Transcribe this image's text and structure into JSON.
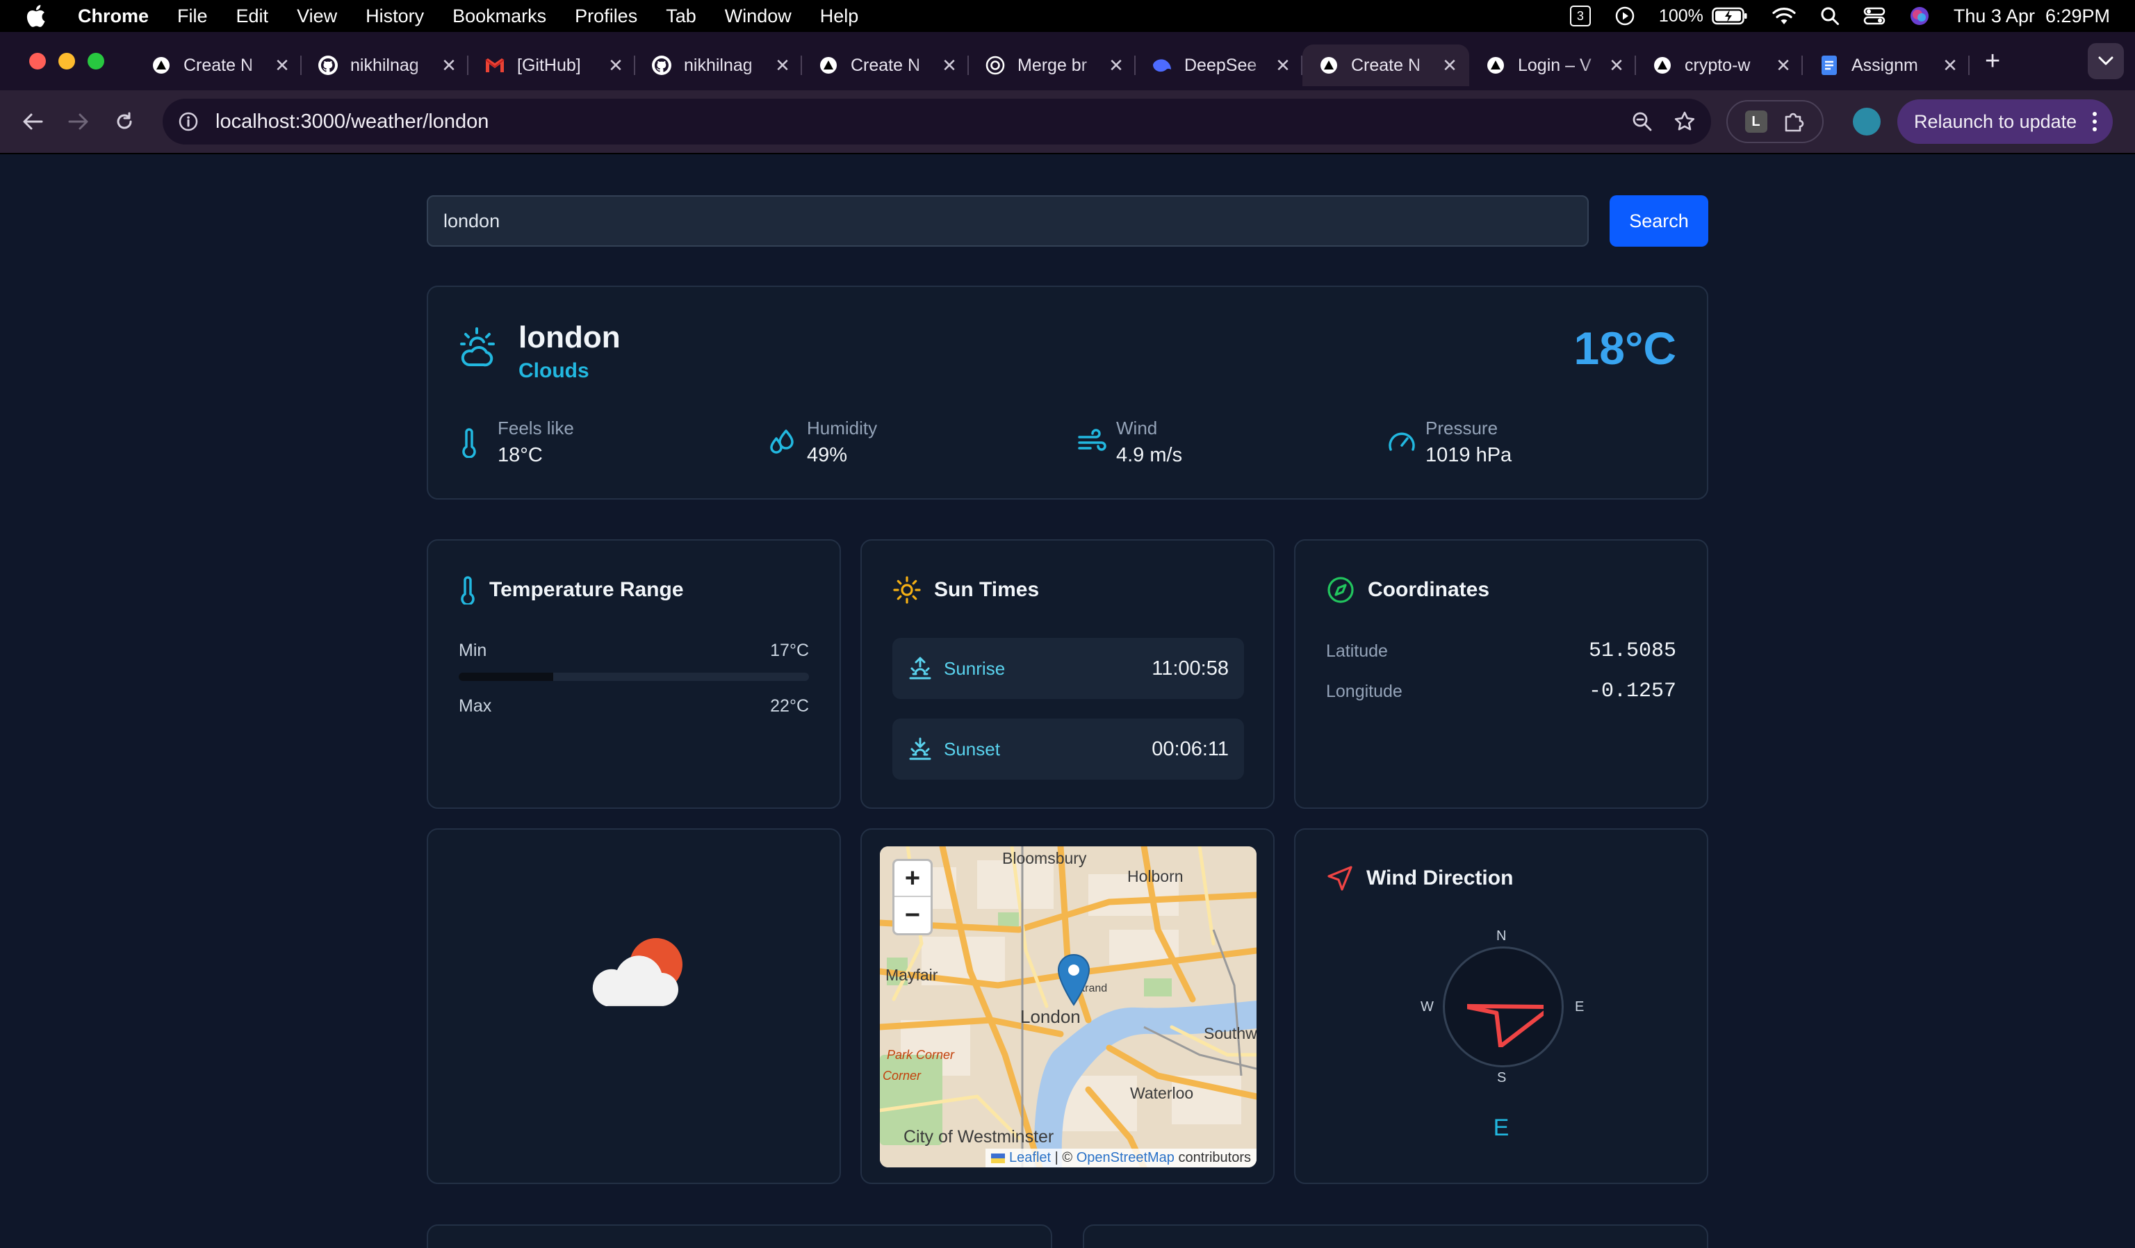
{
  "menubar": {
    "app": "Chrome",
    "items": [
      "File",
      "Edit",
      "View",
      "History",
      "Bookmarks",
      "Profiles",
      "Tab",
      "Window",
      "Help"
    ],
    "battery": "100%",
    "datetime": "Thu 3 Apr  6:29PM",
    "calendar_day": "3"
  },
  "tabs": [
    {
      "label": "Create N",
      "icon": "triangle-icon"
    },
    {
      "label": "nikhilnag",
      "icon": "github-icon"
    },
    {
      "label": "[GitHub]",
      "icon": "gmail-icon"
    },
    {
      "label": "nikhilnag",
      "icon": "github-icon"
    },
    {
      "label": "Create N",
      "icon": "triangle-icon"
    },
    {
      "label": "Merge br",
      "icon": "openai-icon"
    },
    {
      "label": "DeepSee",
      "icon": "deepseek-icon"
    },
    {
      "label": "Create N",
      "icon": "triangle-icon",
      "active": true
    },
    {
      "label": "Login – V",
      "icon": "triangle-icon"
    },
    {
      "label": "crypto-w",
      "icon": "triangle-icon"
    },
    {
      "label": "Assignm",
      "icon": "docs-icon"
    }
  ],
  "toolbar": {
    "url": "localhost:3000/weather/london",
    "ext_letter": "L",
    "relaunch": "Relaunch to update"
  },
  "search": {
    "value": "london",
    "button": "Search"
  },
  "weather": {
    "city": "london",
    "condition": "Clouds",
    "temperature": "18°C",
    "stats": [
      {
        "label": "Feels like",
        "value": "18°C",
        "icon": "thermometer-icon"
      },
      {
        "label": "Humidity",
        "value": "49%",
        "icon": "droplets-icon"
      },
      {
        "label": "Wind",
        "value": "4.9 m/s",
        "icon": "wind-icon"
      },
      {
        "label": "Pressure",
        "value": "1019 hPa",
        "icon": "gauge-icon"
      }
    ]
  },
  "temp_range": {
    "title": "Temperature Range",
    "min_label": "Min",
    "min": "17°C",
    "max_label": "Max",
    "max": "22°C",
    "fill_fraction": 0.27
  },
  "sun_times": {
    "title": "Sun Times",
    "sunrise_label": "Sunrise",
    "sunrise": "11:00:58",
    "sunset_label": "Sunset",
    "sunset": "00:06:11"
  },
  "coordinates": {
    "title": "Coordinates",
    "lat_label": "Latitude",
    "lat": "51.5085",
    "lon_label": "Longitude",
    "lon": "-0.1257"
  },
  "map": {
    "labels": [
      "Bloomsbury",
      "Holborn",
      "Mayfair",
      "London",
      "Strand",
      "Southw",
      "Park Corner",
      "Corner",
      "Waterloo",
      "City of Westminster"
    ],
    "zoom_in": "+",
    "zoom_out": "−",
    "attr_leaflet": "Leaflet",
    "attr_sep": "| ©",
    "attr_osm": "OpenStreetMap",
    "attr_tail": "contributors"
  },
  "wind_direction": {
    "title": "Wind Direction",
    "n": "N",
    "e": "E",
    "s": "S",
    "w": "W",
    "value": "E",
    "colors": {
      "accent": "#ef4444"
    }
  },
  "colors": {
    "background": "#0f172a",
    "card": "#111b2c",
    "accent_cyan": "#22b8e0",
    "accent_blue": "#38a4f0",
    "button": "#0b5cff"
  }
}
